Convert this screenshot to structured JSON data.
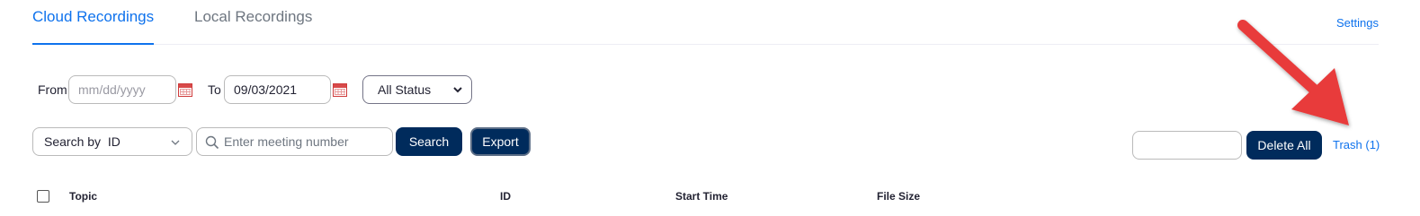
{
  "tabs": [
    {
      "label": "Cloud Recordings",
      "active": true
    },
    {
      "label": "Local Recordings",
      "active": false
    }
  ],
  "header": {
    "settings_label": "Settings"
  },
  "filters": {
    "from_label": "From",
    "from_placeholder": "mm/dd/yyyy",
    "from_value": "",
    "to_label": "To",
    "to_value": "09/03/2021",
    "status_selected": "All Status"
  },
  "search": {
    "search_by_selected": "Search by  ID",
    "meeting_placeholder": "Enter meeting number",
    "search_button": "Search",
    "export_button": "Export"
  },
  "actions": {
    "delete_all_button": "Delete All",
    "trash_link": "Trash (1)"
  },
  "table": {
    "columns": [
      "Topic",
      "ID",
      "Start Time",
      "File Size"
    ]
  },
  "colors": {
    "accent": "#0e72ed",
    "primary_button": "#002b5c",
    "annotation_arrow": "#e83b3b"
  },
  "icons": {
    "calendar": "calendar-icon",
    "dropdown": "chevron-down-icon",
    "search": "search-icon",
    "arrow": "red-arrow-annotation"
  }
}
